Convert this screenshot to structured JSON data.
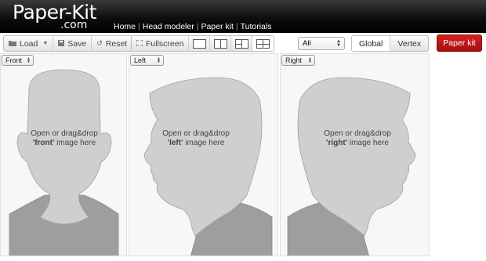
{
  "header": {
    "logo_main": "Paper-Kit",
    "logo_sub": ".com",
    "nav": [
      "Home",
      "Head modeler",
      "Paper kit",
      "Tutorials"
    ]
  },
  "toolbar": {
    "load": "Load",
    "save": "Save",
    "reset": "Reset",
    "fullscreen": "Fullscreen",
    "filter_value": "All",
    "global": "Global",
    "vertex": "Vertex",
    "paper_kit": "Paper kit"
  },
  "panels": [
    {
      "view": "Front",
      "hint_line1": "Open or drag&drop",
      "hint_key": "'front'",
      "hint_rest": " image here"
    },
    {
      "view": "Left",
      "hint_line1": "Open or drag&drop",
      "hint_key": "'left'",
      "hint_rest": " image here"
    },
    {
      "view": "Right",
      "hint_line1": "Open or drag&drop",
      "hint_key": "'right'",
      "hint_rest": " image here"
    }
  ],
  "colors": {
    "head_fill": "#cfcfcf",
    "shirt_fill": "#9e9e9e",
    "outline": "#999999",
    "accent": "#c41616"
  }
}
